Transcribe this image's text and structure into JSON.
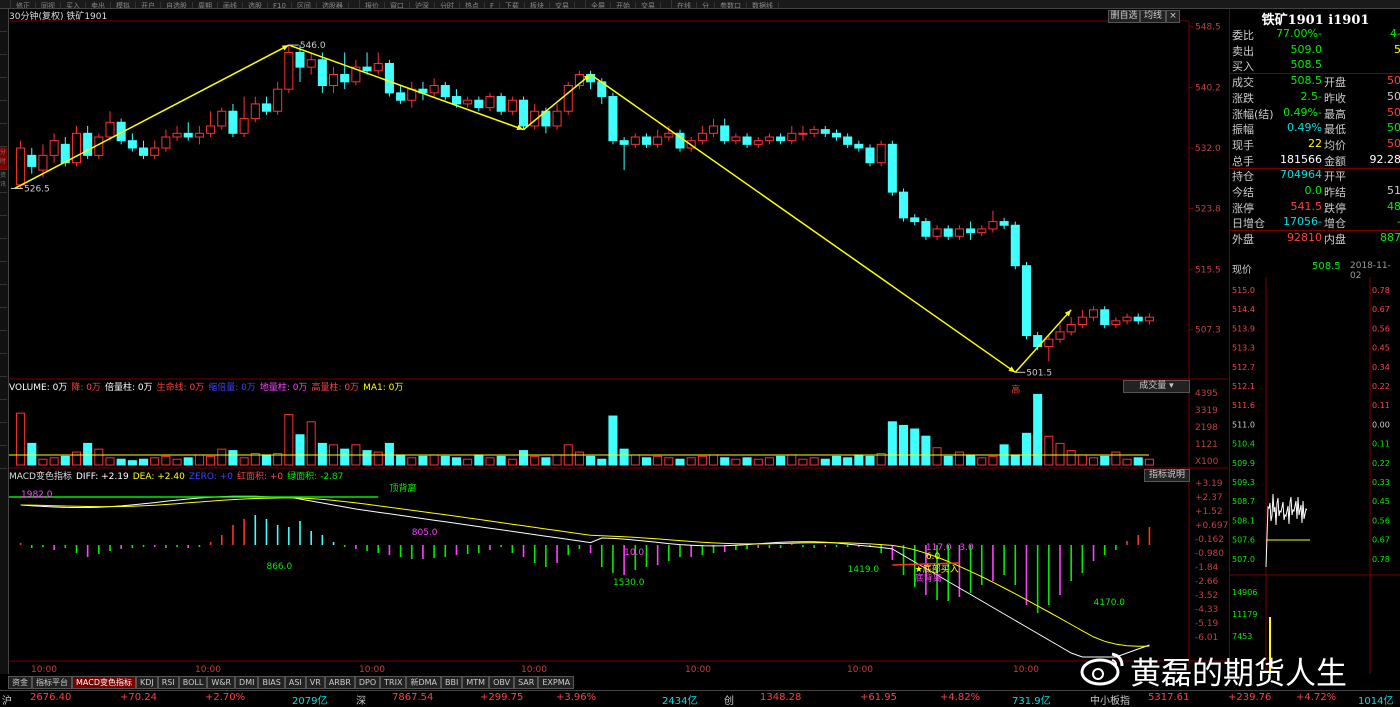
{
  "toolbar": {
    "items": [
      "",
      "修正",
      "同视",
      "买入",
      "卖出",
      "模拟",
      "开户",
      "自选股",
      "周期",
      "画线",
      "选股",
      "F10",
      "区间",
      "选股器",
      "",
      "报价",
      "窗口",
      "沪深",
      "分时",
      "热点",
      "F",
      "下载",
      "板块",
      "交易",
      "",
      "全屏",
      "开始",
      "交易",
      "",
      "在线",
      "分",
      "参数口",
      "数据线"
    ]
  },
  "left_strip": {
    "items": [
      "",
      "",
      "",
      "",
      "",
      "",
      "分时",
      "资讯",
      "",
      "",
      "",
      "",
      "",
      "",
      "",
      "",
      "",
      "",
      "",
      ""
    ]
  },
  "chart_header": {
    "title": "30分钟(复权)  铁矿1901",
    "btn_stack": "删自选",
    "btn_lines": "均线",
    "btn_close": "×"
  },
  "price_axis": [
    "548.5",
    "540.2",
    "532.0",
    "523.8",
    "515.5",
    "507.3"
  ],
  "price_annotations": {
    "high": "546.0",
    "low1": "526.5",
    "low2": "501.5"
  },
  "volume_header": {
    "items": [
      {
        "text": "VOLUME: 0万",
        "color": "#ffffff"
      },
      {
        "text": "降: 0万",
        "color": "#ff4040"
      },
      {
        "text": "倍量柱: 0万",
        "color": "#ffffff"
      },
      {
        "text": "生命线: 0万",
        "color": "#ff4040"
      },
      {
        "text": "缩倍量: 0万",
        "color": "#4040ff"
      },
      {
        "text": "地量柱: 0万",
        "color": "#ff40ff"
      },
      {
        "text": "高量柱: 0万",
        "color": "#ff4040"
      },
      {
        "text": "MA1: 0万",
        "color": "#ffff00"
      }
    ],
    "dropdown": "成交量",
    "high_tag": "高"
  },
  "volume_axis": [
    "4395",
    "3319",
    "2198",
    "1121",
    "X100"
  ],
  "macd_header": {
    "items": [
      {
        "text": "MACD变色指标",
        "color": "#dddddd"
      },
      {
        "text": "DIFF: +2.19",
        "color": "#ffffff"
      },
      {
        "text": "DEA: +2.40",
        "color": "#ffff00"
      },
      {
        "text": "ZERO: +0",
        "color": "#4040ff"
      },
      {
        "text": "红面积: +0",
        "color": "#ff4040"
      },
      {
        "text": "绿面积: -2.87",
        "color": "#00ee00"
      }
    ],
    "help_btn": "指标说明"
  },
  "macd_axis": [
    "+3.19",
    "+2.37",
    "+1.52",
    "+0.697",
    "-0.162",
    "-0.980",
    "-1.84",
    "-2.66",
    "-3.52",
    "-4.33",
    "-5.19",
    "-6.01"
  ],
  "macd_annotations": {
    "a1": "1982.0",
    "a2": "顶背离",
    "a3": "805.0",
    "a4": "866.0",
    "a5": "10.0",
    "a6": "1530.0",
    "a7": "1419.0",
    "a8": "117.0",
    "a9": "3.0",
    "a10": "6.0",
    "a11": "★底部买入",
    "a12": "底背离",
    "a13": "4170.0"
  },
  "time_axis": [
    "10:00",
    "10:00",
    "10:00",
    "10:00",
    "10:00",
    "10:00",
    "10:00"
  ],
  "tabs": [
    "资金",
    "指标平台",
    "MACD变色指标",
    "KDJ",
    "RSI",
    "BOLL",
    "W&R",
    "DMI",
    "BIAS",
    "ASI",
    "VR",
    "ARBR",
    "DPO",
    "TRIX",
    "新DMA",
    "BBI",
    "MTM",
    "OBV",
    "SAR",
    "EXPMA"
  ],
  "quote": {
    "title": "铁矿1901  i1901",
    "rows": [
      {
        "l1": "委比",
        "v1": "-77.00%",
        "c1": "#00ee00",
        "v2": "-4",
        "c2": "#00ee00"
      },
      {
        "l1": "卖出",
        "v1": "509.0",
        "c1": "#00ee00",
        "v2": "5",
        "c2": "#ffff00"
      },
      {
        "l1": "买入",
        "v1": "508.5",
        "c1": "#00ee00",
        "v2": "",
        "c2": "#ffff00"
      },
      {
        "l1": "成交",
        "v1": "508.5",
        "c1": "#00ee00",
        "l2": "开盘",
        "v2": "50",
        "c2": "#ff4040"
      },
      {
        "l1": "涨跌",
        "v1": "-2.5",
        "c1": "#00ee00",
        "l2": "昨收",
        "v2": "50",
        "c2": "#cccccc"
      },
      {
        "l1": "涨幅(结)",
        "v1": "-0.49%",
        "c1": "#00ee00",
        "l2": "最高",
        "v2": "50",
        "c2": "#ff4040"
      },
      {
        "l1": "振幅",
        "v1": "0.49%",
        "c1": "#00e0e0",
        "l2": "最低",
        "v2": "50",
        "c2": "#00ee00"
      },
      {
        "l1": "现手",
        "v1": "22",
        "c1": "#ffff00",
        "l2": "均价",
        "v2": "50",
        "c2": "#ff4040"
      },
      {
        "l1": "总手",
        "v1": "181566",
        "c1": "#ffffff",
        "l2": "金额",
        "v2": "92.28",
        "c2": "#ffffff"
      },
      {
        "l1": "持仓",
        "v1": "704964",
        "c1": "#00e0e0",
        "l2": "开平",
        "v2": "",
        "c2": "#cccccc"
      },
      {
        "l1": "今结",
        "v1": "0.0",
        "c1": "#00ee00",
        "l2": "昨结",
        "v2": "51",
        "c2": "#cccccc"
      },
      {
        "l1": "涨停",
        "v1": "541.5",
        "c1": "#ff4040",
        "l2": "跌停",
        "v2": "48",
        "c2": "#00ee00"
      },
      {
        "l1": "日增仓",
        "v1": "-17056",
        "c1": "#00e0e0",
        "l2": "增仓",
        "v2": "-",
        "c2": "#00ee00"
      },
      {
        "l1": "外盘",
        "v1": "92810",
        "c1": "#ff4040",
        "l2": "内盘",
        "v2": "887",
        "c2": "#00ee00"
      }
    ],
    "last_label": "现价",
    "last_price": "508.5",
    "date": "2018-11-02",
    "mini_left_axis": [
      "515.0",
      "514.4",
      "513.9",
      "513.3",
      "512.7",
      "512.1",
      "511.6",
      "511.0",
      "510.4",
      "509.9",
      "509.3",
      "508.7",
      "508.1",
      "507.6",
      "507.0",
      "14906",
      "11179",
      "7453"
    ],
    "mini_right_axis": [
      "0.78",
      "0.67",
      "0.56",
      "0.45",
      "0.34",
      "0.22",
      "0.11",
      "0.00",
      "0.11",
      "0.22",
      "0.33",
      "0.45",
      "0.56",
      "0.67",
      "0.78"
    ]
  },
  "status_bar": {
    "items": [
      {
        "text": "沪",
        "color": "#cccccc"
      },
      {
        "text": "2676.40",
        "color": "#ff4040"
      },
      {
        "text": "+70.24",
        "color": "#ff4040"
      },
      {
        "text": "+2.70%",
        "color": "#ff4040"
      },
      {
        "text": "2079亿",
        "color": "#00e0e0"
      },
      {
        "text": "深",
        "color": "#cccccc"
      },
      {
        "text": "7867.54",
        "color": "#ff4040"
      },
      {
        "text": "+299.75",
        "color": "#ff4040"
      },
      {
        "text": "+3.96%",
        "color": "#ff4040"
      },
      {
        "text": "2434亿",
        "color": "#00e0e0"
      },
      {
        "text": "创",
        "color": "#cccccc"
      },
      {
        "text": "1348.28",
        "color": "#ff4040"
      },
      {
        "text": "+61.95",
        "color": "#ff4040"
      },
      {
        "text": "+4.82%",
        "color": "#ff4040"
      },
      {
        "text": "731.9亿",
        "color": "#00e0e0"
      },
      {
        "text": "中小板指",
        "color": "#cccccc"
      },
      {
        "text": "5317.61",
        "color": "#ff4040"
      },
      {
        "text": "+239.76",
        "color": "#ff4040"
      },
      {
        "text": "+4.72%",
        "color": "#ff4040"
      },
      {
        "text": "1014亿",
        "color": "#00e0e0"
      }
    ]
  },
  "watermark": {
    "text": "黄磊的期货人生"
  },
  "chart_data": [
    {
      "type": "candlestick",
      "title": "铁矿1901",
      "period": "30分钟",
      "ylim": [
        501,
        549
      ],
      "ticks": [
        548.5,
        540.2,
        532.0,
        523.8,
        515.5,
        507.3
      ],
      "candles": [
        [
          527,
          532,
          526.5,
          533
        ],
        [
          531,
          529.5,
          528.5,
          532
        ],
        [
          529,
          531,
          528,
          532.5
        ],
        [
          531,
          533,
          530,
          534
        ],
        [
          532.5,
          530,
          529.5,
          533.5
        ],
        [
          530,
          534,
          529.5,
          535
        ],
        [
          534,
          531,
          530.5,
          535
        ],
        [
          531,
          533.5,
          530.5,
          534
        ],
        [
          533.5,
          535.5,
          533,
          537
        ],
        [
          535.5,
          533,
          532.5,
          536
        ],
        [
          533,
          532,
          531.5,
          534
        ],
        [
          532,
          531,
          530.5,
          533
        ],
        [
          531,
          532,
          530.5,
          533
        ],
        [
          532,
          533.5,
          531.5,
          534.5
        ],
        [
          533.5,
          534,
          533,
          535
        ],
        [
          534,
          533.5,
          533,
          535.5
        ],
        [
          533.5,
          534,
          532.5,
          535
        ],
        [
          534,
          535,
          533.5,
          537
        ],
        [
          535,
          537,
          534.5,
          537.5
        ],
        [
          537,
          534,
          533.5,
          538
        ],
        [
          534,
          536,
          533.5,
          539
        ],
        [
          536,
          538,
          535.5,
          539
        ],
        [
          538,
          537,
          536.5,
          539
        ],
        [
          537,
          540,
          536.5,
          541
        ],
        [
          540,
          545,
          539.5,
          546
        ],
        [
          545,
          543,
          541,
          546
        ],
        [
          543,
          544,
          542,
          545
        ],
        [
          544,
          540.5,
          539.5,
          545
        ],
        [
          540.5,
          542,
          539.5,
          543
        ],
        [
          542,
          541,
          540,
          545
        ],
        [
          541,
          543,
          540.5,
          544
        ],
        [
          543,
          542.5,
          542,
          545
        ],
        [
          542.5,
          543.5,
          542,
          545
        ],
        [
          543.5,
          539.5,
          539,
          544
        ],
        [
          539.5,
          538.5,
          538,
          540.5
        ],
        [
          538.5,
          540,
          537.5,
          541
        ],
        [
          540,
          539.5,
          538.5,
          541
        ],
        [
          539.5,
          540.5,
          539,
          541.5
        ],
        [
          540.5,
          539,
          538.5,
          541
        ],
        [
          539,
          538,
          537.5,
          540
        ],
        [
          538,
          538.5,
          537.5,
          539
        ],
        [
          538.5,
          537.5,
          537,
          539
        ],
        [
          537.5,
          539,
          537,
          539.5
        ],
        [
          539,
          537,
          536.5,
          539.5
        ],
        [
          537,
          538.5,
          536.5,
          539
        ],
        [
          538.5,
          535,
          534.5,
          539
        ],
        [
          535,
          537,
          534.5,
          538
        ],
        [
          537,
          535,
          534,
          537.5
        ],
        [
          535,
          537,
          534.5,
          538
        ],
        [
          537,
          540.5,
          536.5,
          541
        ],
        [
          540.5,
          542,
          540,
          542.5
        ],
        [
          542,
          541,
          540,
          542.5
        ],
        [
          541,
          539,
          538,
          541.5
        ],
        [
          539,
          533,
          532.5,
          539.5
        ],
        [
          533,
          532.5,
          529,
          533.5
        ],
        [
          532.5,
          533.5,
          532,
          534
        ],
        [
          533.5,
          532.5,
          532,
          534
        ],
        [
          532.5,
          533.5,
          532,
          534.5
        ],
        [
          533.5,
          534,
          533,
          535
        ],
        [
          534,
          532,
          531.5,
          534.5
        ],
        [
          532,
          533,
          531.5,
          533.5
        ],
        [
          533,
          534,
          532.5,
          535
        ],
        [
          534,
          535,
          533.5,
          536
        ],
        [
          535,
          533,
          532.5,
          536
        ],
        [
          533,
          533.5,
          532.5,
          534
        ],
        [
          533.5,
          532.5,
          532,
          534
        ],
        [
          532.5,
          533,
          532,
          533.5
        ],
        [
          533,
          533.5,
          532.5,
          534
        ],
        [
          533.5,
          533,
          532.5,
          534
        ],
        [
          533,
          534,
          532.5,
          535
        ],
        [
          534,
          534,
          533,
          535
        ],
        [
          534,
          534.5,
          533.5,
          535
        ],
        [
          534.5,
          534,
          533.5,
          535
        ],
        [
          534,
          533.5,
          533,
          534.5
        ],
        [
          533.5,
          532.5,
          532,
          534
        ],
        [
          532.5,
          532,
          531.5,
          533
        ],
        [
          532,
          530,
          529.5,
          532.5
        ],
        [
          530,
          532.5,
          529.5,
          533
        ],
        [
          532.5,
          526,
          525.5,
          533
        ],
        [
          526,
          522.5,
          522,
          526.5
        ],
        [
          522.5,
          522,
          521.5,
          523
        ],
        [
          522,
          520,
          519.5,
          522.5
        ],
        [
          520,
          521,
          519.5,
          521.5
        ],
        [
          521,
          520,
          519.5,
          521.5
        ],
        [
          520,
          521,
          519.5,
          521.5
        ],
        [
          521,
          520.5,
          519.5,
          522
        ],
        [
          520.5,
          521,
          520,
          521.5
        ],
        [
          521,
          522,
          520.5,
          523.5
        ],
        [
          522,
          521.5,
          521,
          522.5
        ],
        [
          521.5,
          516,
          515.5,
          522
        ],
        [
          516,
          506.5,
          506,
          516.5
        ],
        [
          506.5,
          505,
          504.5,
          507
        ],
        [
          505,
          506,
          503,
          506.5
        ],
        [
          506,
          507,
          505.5,
          508
        ],
        [
          507,
          508,
          506.5,
          509
        ],
        [
          508,
          509,
          507.5,
          510
        ],
        [
          509,
          510,
          508.5,
          510.5
        ],
        [
          510,
          508,
          507.5,
          510.5
        ],
        [
          508,
          508.5,
          507.5,
          509
        ],
        [
          508.5,
          509,
          508,
          509.5
        ],
        [
          509,
          508.5,
          508,
          509.5
        ],
        [
          508.5,
          509,
          508,
          509.5
        ]
      ],
      "zigzag": [
        [
          0,
          526.5
        ],
        [
          24,
          546.0
        ],
        [
          45,
          534.5
        ],
        [
          51,
          542.0
        ],
        [
          89,
          501.5
        ],
        [
          94,
          510.0
        ]
      ]
    }
  ]
}
